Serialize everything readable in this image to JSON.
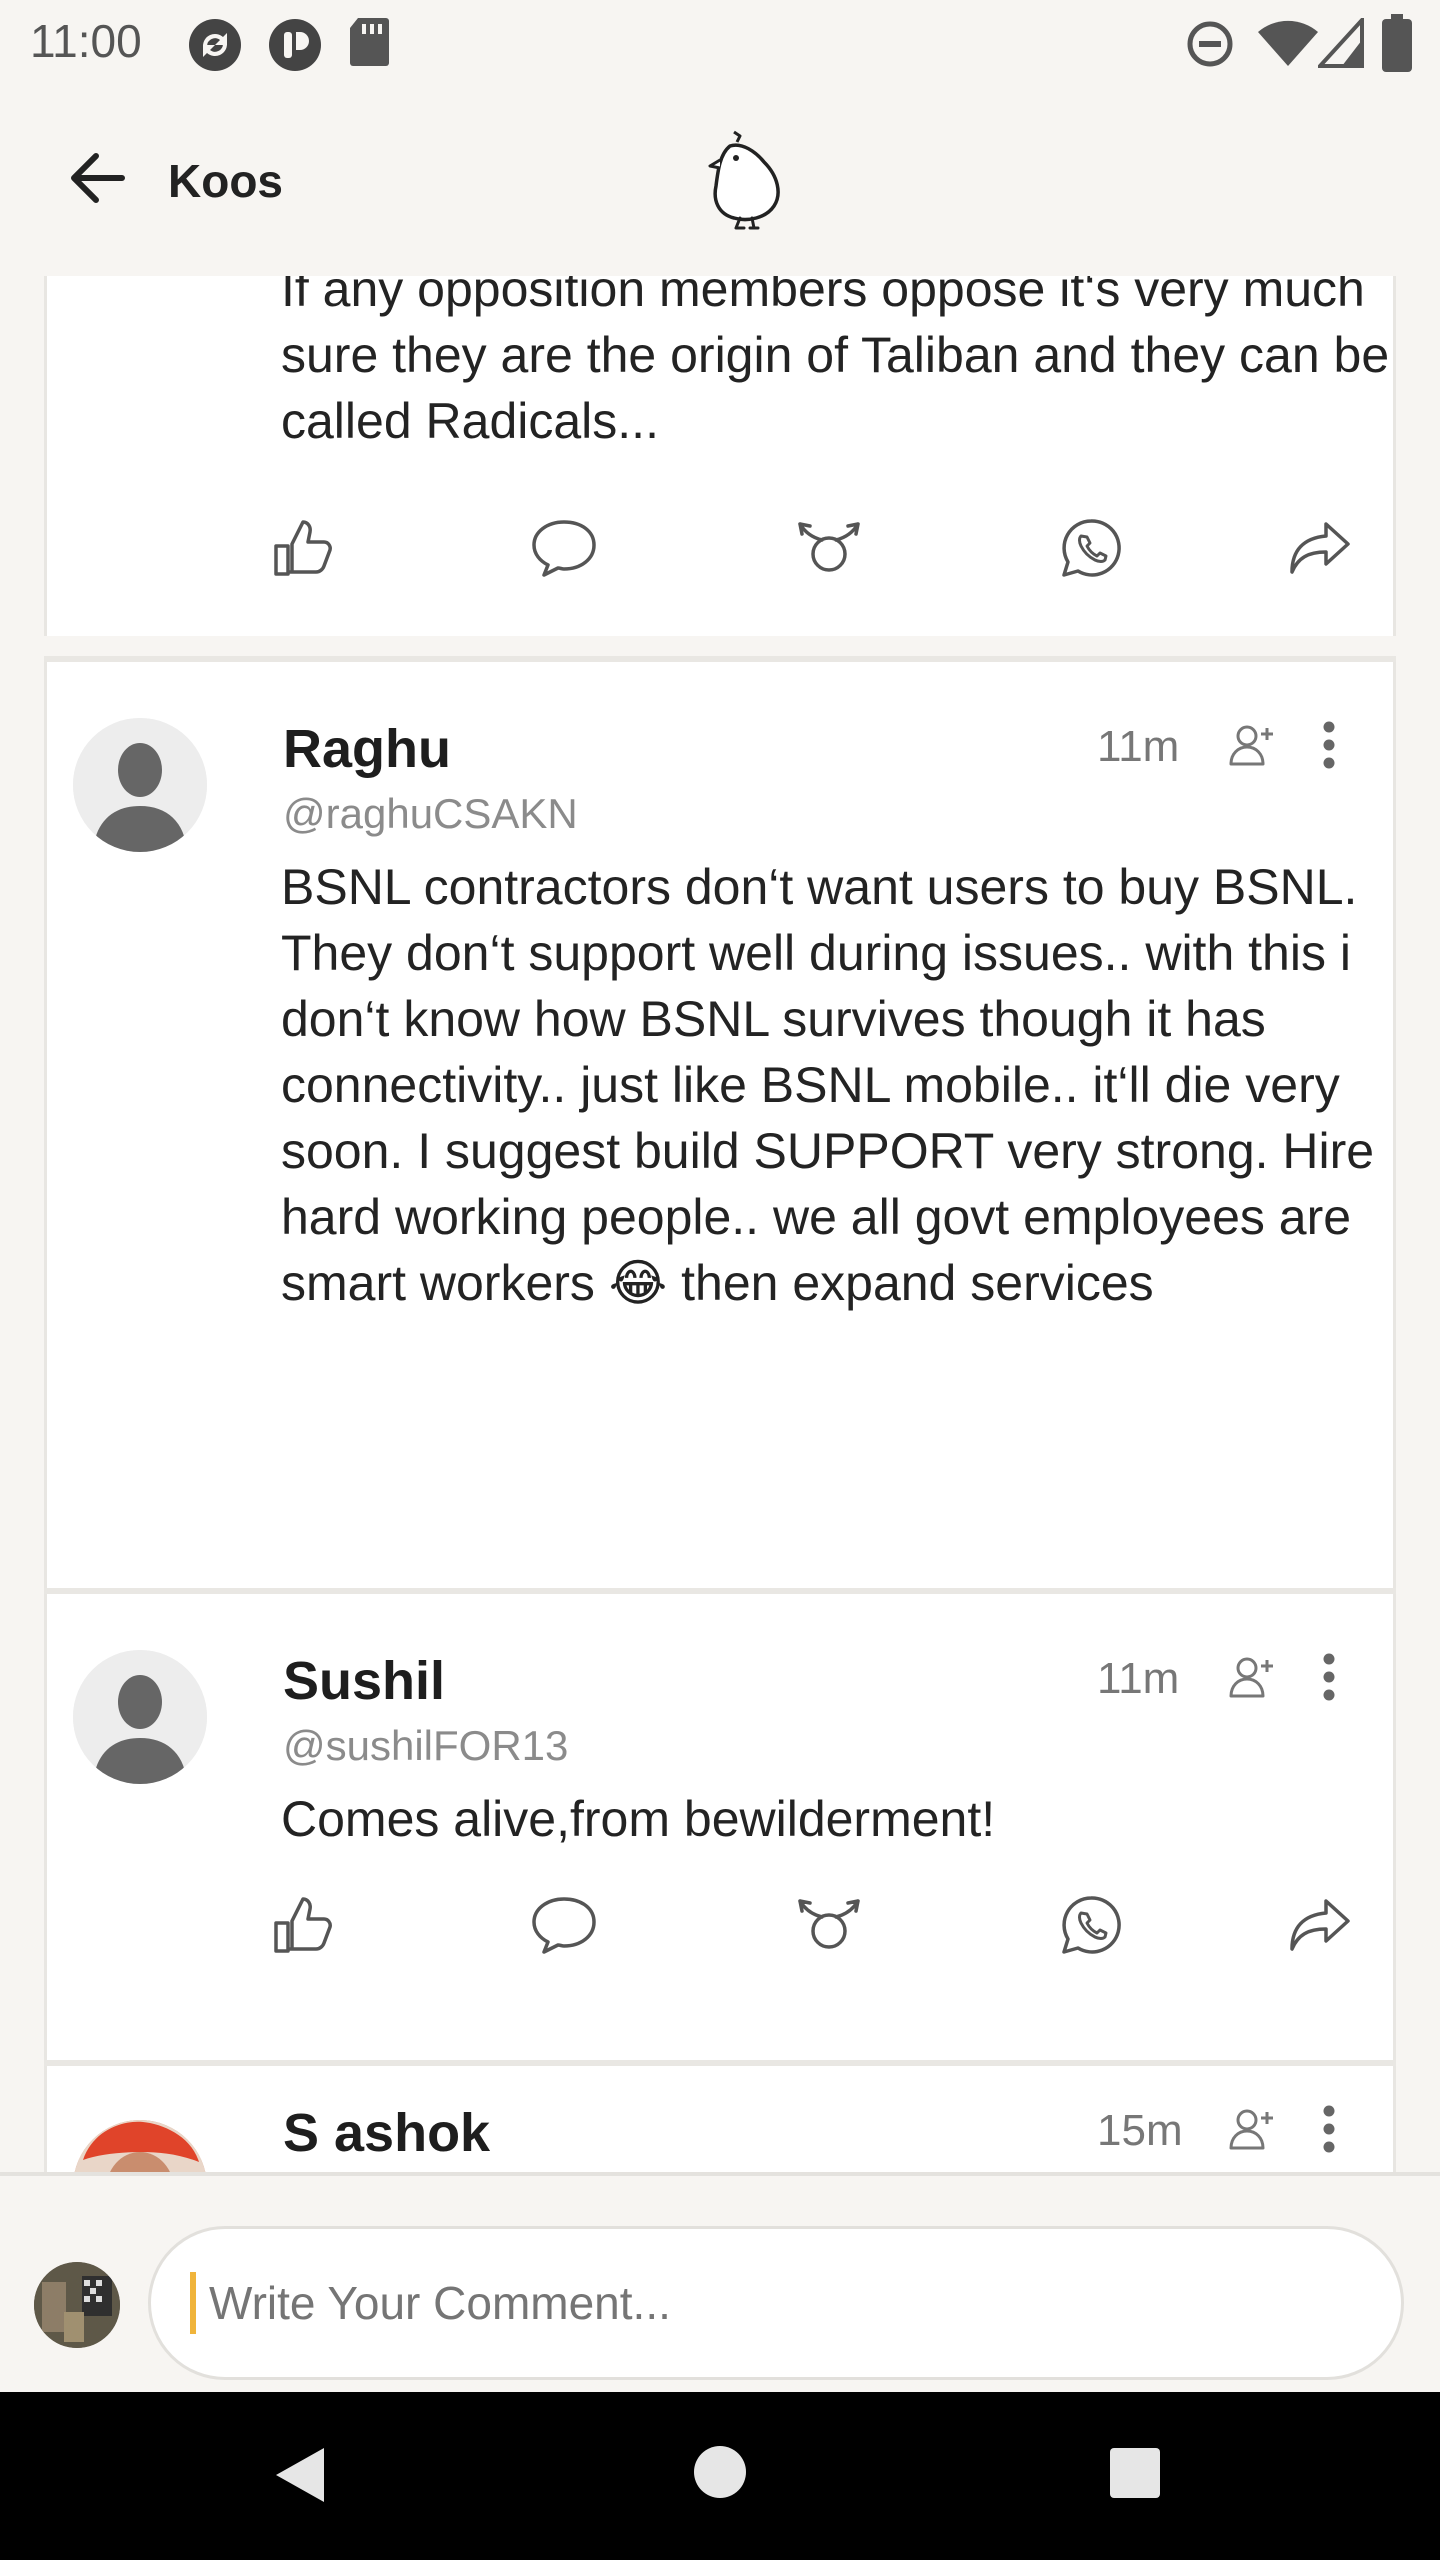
{
  "status_bar": {
    "time": "11:00"
  },
  "app_bar": {
    "title": "Koos"
  },
  "posts": [
    {
      "text": "If any opposition members oppose it‘s very much sure they are the origin of Taliban and they can be called Radicals..."
    },
    {
      "name": "Raghu",
      "handle": "@raghuCSAKN",
      "time": "11m",
      "text": "BSNL contractors don‘t want users to buy BSNL. They don‘t support well during issues.. with this i don‘t know how BSNL survives though it has connectivity.. just like BSNL mobile.. it‘ll die very soon. I suggest build SUPPORT very strong. Hire hard working people.. we all govt employees are smart workers 😂 then expand services"
    },
    {
      "name": "Sushil",
      "handle": "@sushilFOR13",
      "time": "11m",
      "text": "Comes alive,from bewilderment!"
    },
    {
      "name": "S ashok",
      "time": "15m"
    }
  ],
  "composer": {
    "placeholder": "Write Your Comment..."
  },
  "colors": {
    "accent": "#f0b43b",
    "background": "#f7f5f2",
    "icon": "#555555"
  }
}
